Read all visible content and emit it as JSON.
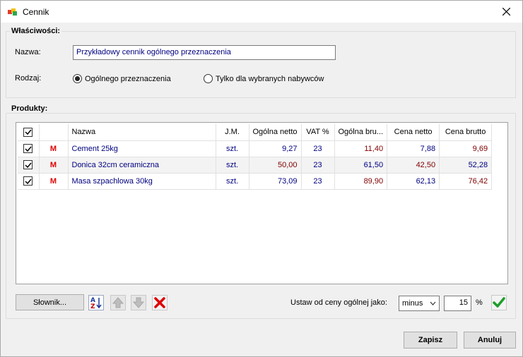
{
  "window": {
    "title": "Cennik"
  },
  "properties": {
    "legend": "Właściwości:",
    "name_label": "Nazwa:",
    "name_value": "Przykładowy cennik ogólnego przeznaczenia",
    "type_label": "Rodzaj:",
    "radio_general": "Ogólnego przeznaczenia",
    "radio_selected": "Tylko dla wybranych nabywców",
    "selected": "general"
  },
  "products": {
    "legend": "Produkty:",
    "columns": [
      "Nazwa",
      "J.M.",
      "Ogólna netto",
      "VAT %",
      "Ogólna bru...",
      "Cena netto",
      "Cena brutto"
    ],
    "rows": [
      {
        "checked": true,
        "mark": "M",
        "name": "Cement 25kg",
        "unit": "szt.",
        "net": "9,27",
        "vat": "23",
        "gross": "11,40",
        "price_net": "7,88",
        "price_gross": "9,69"
      },
      {
        "checked": true,
        "mark": "M",
        "name": "Donica 32cm ceramiczna",
        "unit": "szt.",
        "net": "50,00",
        "vat": "23",
        "gross": "61,50",
        "price_net": "42,50",
        "price_gross": "52,28"
      },
      {
        "checked": true,
        "mark": "M",
        "name": "Masa szpachlowa 30kg",
        "unit": "szt.",
        "net": "73,09",
        "vat": "23",
        "gross": "89,90",
        "price_net": "62,13",
        "price_gross": "76,42"
      }
    ]
  },
  "toolbar": {
    "dictionary_label": "Słownik...",
    "set_from_label": "Ustaw od ceny ogólnej jako:",
    "mode_value": "minus",
    "percent_value": "15",
    "percent_sign": "%"
  },
  "footer": {
    "save_label": "Zapisz",
    "cancel_label": "Anuluj"
  },
  "icons": [
    "app-cubes-icon",
    "close-icon",
    "sort-az-icon",
    "arrow-up-icon",
    "arrow-down-icon",
    "delete-icon",
    "chevron-down-icon",
    "apply-check-icon"
  ]
}
